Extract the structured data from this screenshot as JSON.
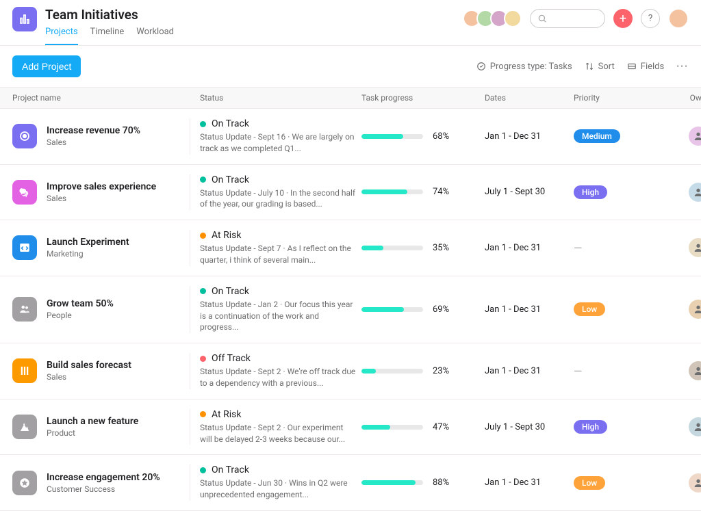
{
  "header": {
    "title": "Team Initiatives",
    "tabs": [
      {
        "label": "Projects",
        "active": true
      },
      {
        "label": "Timeline",
        "active": false
      },
      {
        "label": "Workload",
        "active": false
      }
    ]
  },
  "toolbar": {
    "add_project": "Add Project",
    "progress_type": "Progress type: Tasks",
    "sort": "Sort",
    "fields": "Fields"
  },
  "columns": {
    "project": "Project name",
    "status": "Status",
    "progress": "Task progress",
    "dates": "Dates",
    "priority": "Priority",
    "owner": "Owner"
  },
  "priorities": {
    "medium": "Medium",
    "high": "High",
    "low": "Low"
  },
  "projects": [
    {
      "name": "Increase revenue 70%",
      "team": "Sales",
      "icon_bg": "#7a6ff0",
      "icon": "target",
      "status": "On Track",
      "status_tone": "green",
      "status_sub": "Status Update - Sept 16 · We are largely on track as we completed Q1...",
      "progress": 68,
      "dates": "Jan 1 - Dec 31",
      "priority": "medium",
      "owner_cl": "oa1"
    },
    {
      "name": "Improve sales experience",
      "team": "Sales",
      "icon_bg": "#e362e3",
      "icon": "chat",
      "status": "On Track",
      "status_tone": "green",
      "status_sub": "Status Update - July 10 · In the second half of the year, our grading is based...",
      "progress": 74,
      "dates": "July 1 - Sept 30",
      "priority": "high",
      "owner_cl": "oa2"
    },
    {
      "name": "Launch Experiment",
      "team": "Marketing",
      "icon_bg": "#208deb",
      "icon": "code",
      "status": "At Risk",
      "status_tone": "orange",
      "status_sub": "Status Update - Sept 7 · As I reflect on the quarter, i think of several main...",
      "progress": 35,
      "dates": "Jan 1 - Dec 31",
      "priority": "",
      "owner_cl": "oa3"
    },
    {
      "name": "Grow team 50%",
      "team": "People",
      "icon_bg": "#a2a0a2",
      "icon": "people",
      "status": "On Track",
      "status_tone": "green",
      "status_sub": "Status Update - Jan 2 · Our focus this year is a continuation of the work and progress...",
      "progress": 69,
      "dates": "Jan 1 - Dec 31",
      "priority": "low",
      "owner_cl": "oa4"
    },
    {
      "name": "Build sales forecast",
      "team": "Sales",
      "icon_bg": "#fd9a00",
      "icon": "columns",
      "status": "Off Track",
      "status_tone": "red",
      "status_sub": "Status Update - Sept 2 · We're off track due to a dependency with a previous...",
      "progress": 23,
      "dates": "Jan 1 - Dec 31",
      "priority": "",
      "owner_cl": "oa5"
    },
    {
      "name": "Launch a new feature",
      "team": "Product",
      "icon_bg": "#a2a0a2",
      "icon": "mountain",
      "status": "At Risk",
      "status_tone": "orange",
      "status_sub": "Status Update - Sept 2 · Our experiment will be delayed 2-3 weeks because our...",
      "progress": 47,
      "dates": "July 1 - Sept 30",
      "priority": "high",
      "owner_cl": "oa6"
    },
    {
      "name": "Increase engagement 20%",
      "team": "Customer Success",
      "icon_bg": "#a2a0a2",
      "icon": "star",
      "status": "On Track",
      "status_tone": "green",
      "status_sub": "Status Update - Jun 30 · Wins in Q2 were unprecedented engagement...",
      "progress": 88,
      "dates": "Jan 1 - Dec 31",
      "priority": "low",
      "owner_cl": "oa7"
    }
  ]
}
